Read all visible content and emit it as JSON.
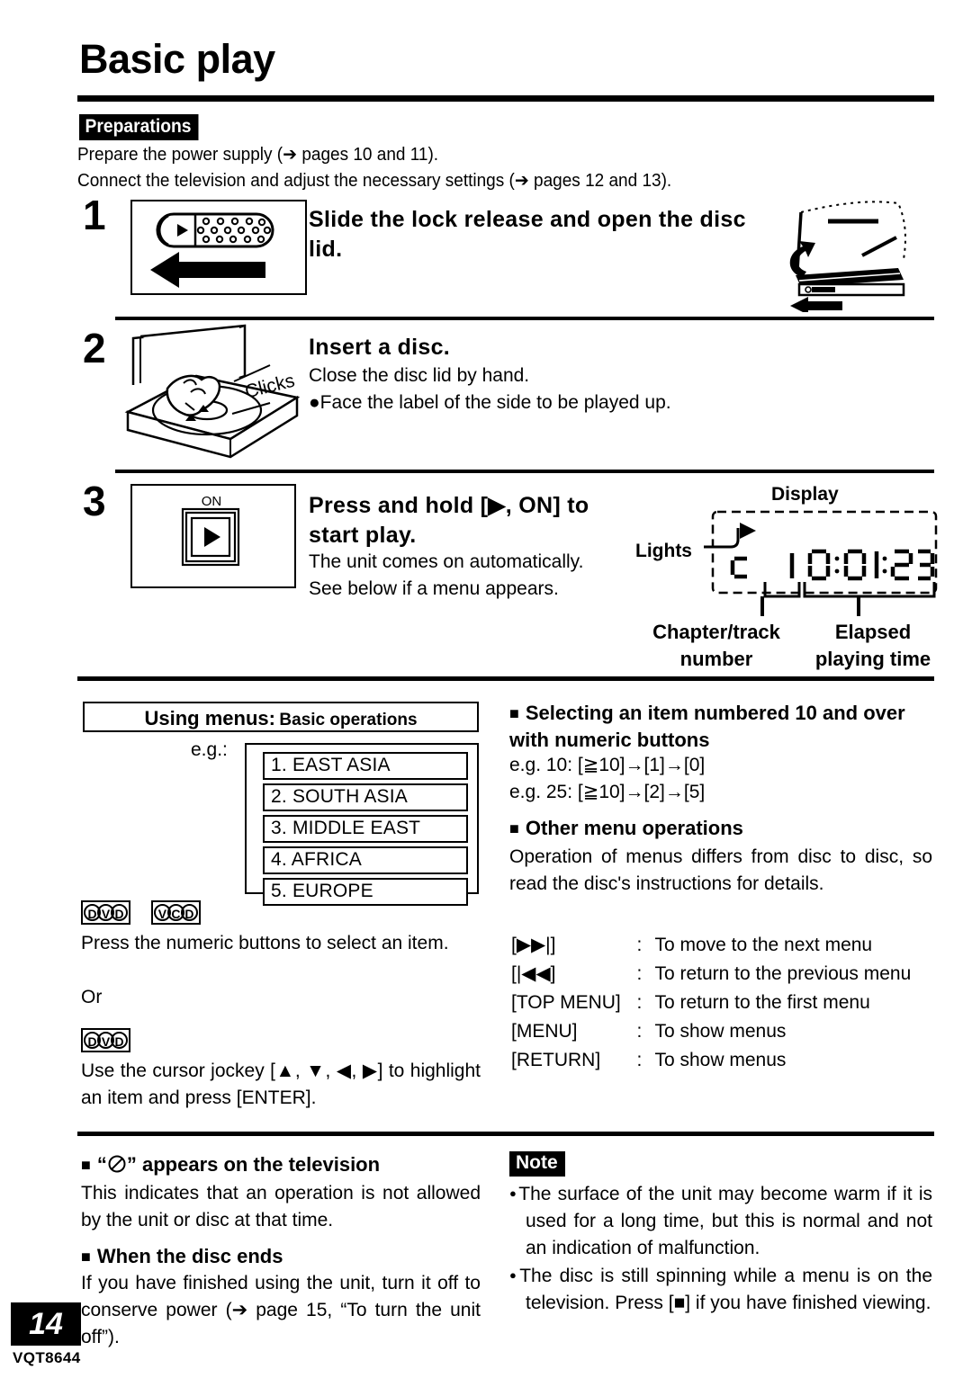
{
  "page": {
    "title": "Basic play",
    "number": "14",
    "part_number": "VQT8644"
  },
  "preparations": {
    "badge": "Preparations",
    "items": [
      "Prepare the power supply (➔ pages 10 and 11).",
      "Connect the television and adjust the necessary settings (➔ pages 12 and 13)."
    ]
  },
  "steps": [
    {
      "number": "1",
      "heading": "Slide the lock release and open the disc lid.",
      "body": []
    },
    {
      "number": "2",
      "heading": "Insert a disc.",
      "body": [
        "Close the disc lid by hand.",
        "●Face the label of the side to be played up."
      ],
      "art_caption": "Clicks"
    },
    {
      "number": "3",
      "heading": "Press and hold [▶, ON] to start play.",
      "body": [
        "The unit comes on automatically.",
        "See below if a menu appears."
      ],
      "art_label": "ON"
    }
  ],
  "display_callout": {
    "title": "Display",
    "lights_label": "Lights",
    "chapter_label_line1": "Chapter/track",
    "chapter_label_line2": "number",
    "elapsed_label_line1": "Elapsed",
    "elapsed_label_line2": "playing time",
    "lcd_chapter": "C   1",
    "lcd_time": "0:01:23"
  },
  "using_menus": {
    "title_main": "Using menus:",
    "title_sub": "Basic operations",
    "eg_label": "e.g.:",
    "menu_items": [
      "1. EAST ASIA",
      "2. SOUTH ASIA",
      "3. MIDDLE EAST",
      "4. AFRICA",
      "5. EUROPE"
    ],
    "badges_1": [
      "DVD",
      "VCD"
    ],
    "text_1": "Press the numeric buttons to select an item.",
    "or_text": "Or",
    "badges_2": [
      "DVD"
    ],
    "text_2": "Use the cursor jockey [▲, ▼, ◀, ▶] to highlight an item and press [ENTER]."
  },
  "numeric_section": {
    "heading": "Selecting an item numbered 10 and over with numeric buttons",
    "examples": [
      "e.g. 10:  [≧10]→[1]→[0]",
      "e.g. 25:  [≧10]→[2]→[5]"
    ]
  },
  "other_menu_section": {
    "heading": "Other menu operations",
    "text": "Operation of menus differs from disc to disc, so read the disc's instructions for details.",
    "keys": [
      {
        "key": "[▶▶|]",
        "sep": ":",
        "desc": "To move to the next menu"
      },
      {
        "key": "[|◀◀]",
        "sep": ":",
        "desc": "To return to the previous menu"
      },
      {
        "key": "[TOP MENU]",
        "sep": ":",
        "desc": "To return to the first menu"
      },
      {
        "key": "[MENU]",
        "sep": ":",
        "desc": "To show menus"
      },
      {
        "key": "[RETURN]",
        "sep": ":",
        "desc": "To show menus"
      }
    ]
  },
  "prohibited_section": {
    "heading_pre": "“",
    "heading_post": "” appears on the television",
    "text": "This indicates that an operation is not allowed by the unit or disc at that time."
  },
  "disc_ends_section": {
    "heading": "When the disc ends",
    "text": "If you have finished using the unit, turn it off to conserve power (➔ page 15, “To turn the unit off”)."
  },
  "note_section": {
    "badge": "Note",
    "items": [
      "The surface of the unit may become warm if it is used for a long time, but this is normal and not an indication of malfunction.",
      "The disc is still spinning while a menu is on the television. Press [■] if you have finished viewing."
    ]
  }
}
